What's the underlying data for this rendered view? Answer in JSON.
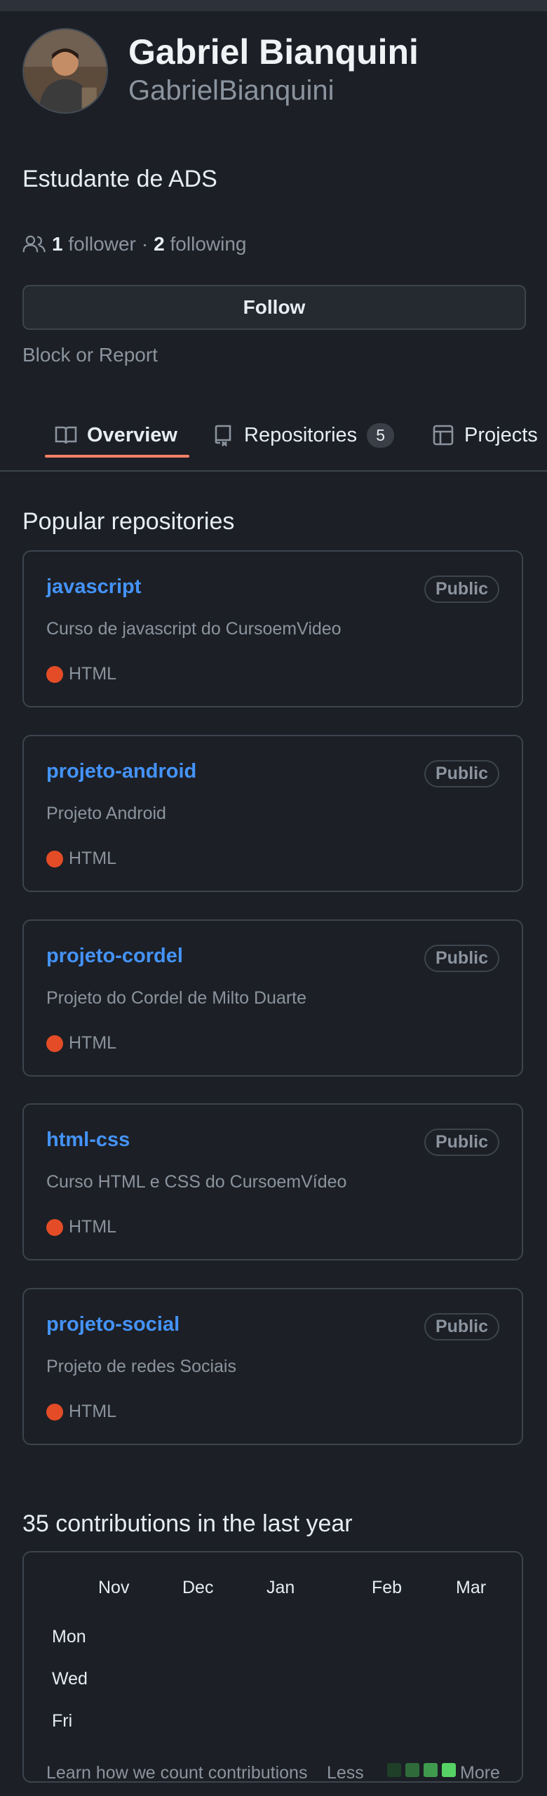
{
  "profile": {
    "full_name": "Gabriel Bianquini",
    "login": "GabrielBianquini",
    "bio": "Estudante de ADS",
    "followers_count": "1",
    "followers_label": "follower",
    "separator": "·",
    "following_count": "2",
    "following_label": "following",
    "follow_button": "Follow",
    "block_report": "Block or Report"
  },
  "tabs": [
    {
      "label": "Overview",
      "icon": "book-icon"
    },
    {
      "label": "Repositories",
      "icon": "repo-icon",
      "count": "5"
    },
    {
      "label": "Projects",
      "icon": "table-icon"
    }
  ],
  "popular": {
    "title": "Popular repositories",
    "repos": [
      {
        "name": "javascript",
        "visibility": "Public",
        "description": "Curso de javascript do CursoemVideo",
        "language": "HTML"
      },
      {
        "name": "projeto-android",
        "visibility": "Public",
        "description": "Projeto Android",
        "language": "HTML"
      },
      {
        "name": "projeto-cordel",
        "visibility": "Public",
        "description": "Projeto do Cordel de Milto Duarte",
        "language": "HTML"
      },
      {
        "name": "html-css",
        "visibility": "Public",
        "description": "Curso HTML e CSS do CursoemVídeo",
        "language": "HTML"
      },
      {
        "name": "projeto-social",
        "visibility": "Public",
        "description": "Projeto de redes Sociais",
        "language": "HTML"
      }
    ],
    "language_color": "#e34c26"
  },
  "contributions": {
    "title": "35 contributions in the last year",
    "months": [
      "Nov",
      "Dec",
      "Jan",
      "Feb",
      "Mar"
    ],
    "days": [
      "Mon",
      "Wed",
      "Fri"
    ],
    "learn_link": "Learn how we count contributions",
    "less": "Less",
    "more": "More",
    "legend_colors": [
      "#1f3f28",
      "#2f6b3a",
      "#3f9a4e",
      "#56d364"
    ]
  },
  "colors": {
    "background": "#1c1f26",
    "link": "#4493f8",
    "tab_underline": "#f78166"
  }
}
